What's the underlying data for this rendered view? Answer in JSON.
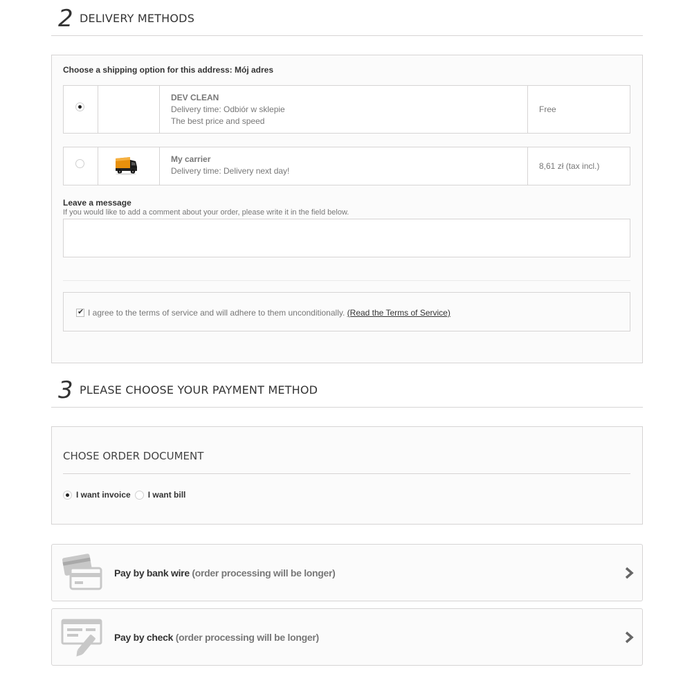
{
  "delivery": {
    "step_number": "2",
    "title": "DELIVERY METHODS",
    "choose_label": "Choose a shipping option for this address: Mój adres",
    "carriers": [
      {
        "name": "DEV CLEAN",
        "delivery_time": "Delivery time: Odbiór w sklepie",
        "description": "The best price and speed",
        "price": "Free",
        "selected": true,
        "logo_icon": ""
      },
      {
        "name": "My carrier",
        "delivery_time": "Delivery time: Delivery next day!",
        "description": "",
        "price": "8,61 zł (tax incl.)",
        "selected": false,
        "logo_icon": "truck-icon"
      }
    ],
    "message": {
      "title": "Leave a message",
      "hint": "If you would like to add a comment about your order, please write it in the field below.",
      "value": ""
    },
    "terms": {
      "checked": true,
      "text": "I agree to the terms of service and will adhere to them unconditionally.",
      "link": "(Read the Terms of Service)"
    }
  },
  "payment": {
    "step_number": "3",
    "title": "PLEASE CHOOSE YOUR PAYMENT METHOD",
    "document": {
      "title": "CHOSE ORDER DOCUMENT",
      "options": [
        {
          "label": "I want invoice",
          "selected": true
        },
        {
          "label": "I want bill",
          "selected": false
        }
      ]
    },
    "methods": [
      {
        "name": "Pay by bank wire",
        "note": "(order processing will be longer)",
        "icon": "credit-card-icon"
      },
      {
        "name": "Pay by check",
        "note": "(order processing will be longer)",
        "icon": "check-pen-icon"
      }
    ]
  },
  "colors": {
    "border": "#d6d4d4",
    "box_bg": "#fbfbfb",
    "muted_text": "#777777",
    "icon_gray": "#c8c8c8"
  }
}
